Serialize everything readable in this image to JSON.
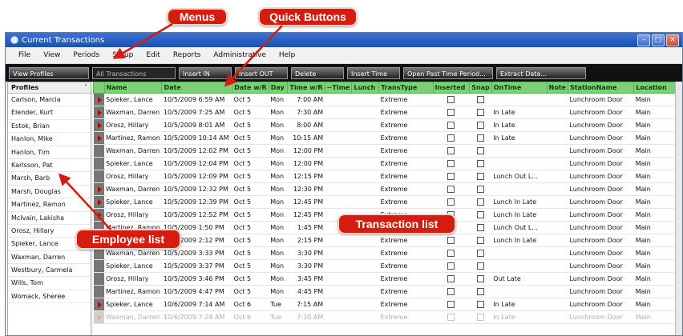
{
  "window": {
    "title": "Current Transactions"
  },
  "menu": [
    "File",
    "View",
    "Periods",
    "Setup",
    "Edit",
    "Reports",
    "Administrative",
    "Help"
  ],
  "toolbar": {
    "view_profiles": "View Profiles",
    "filter": "All Transactions",
    "buttons": [
      "Insert IN",
      "Insert OUT",
      "Delete",
      "Insert Time",
      "Open Past Time Period...",
      "Extract Data..."
    ]
  },
  "profiles": {
    "header": "Profiles",
    "items": [
      "Carlson, Marcia",
      "Elender, Kurt",
      "Estok, Brian",
      "Hanlon, Mike",
      "Hanlon, Tim",
      "Karlsson, Pat",
      "Marsh, Barb",
      "Marsh, Douglas",
      "Martinez, Ramon",
      "McIvain, Lakisha",
      "Orosz, Hillary",
      "Spieker, Lance",
      "Waxman, Darren",
      "Westbury, Carmela",
      "Wills, Tom",
      "Womack, Sheree"
    ]
  },
  "columns": [
    "Name",
    "Date",
    "Date w/R",
    "Day",
    "Time w/R",
    "~Time",
    "Lunch",
    "TransType",
    "Inserted",
    "Snap",
    "OnTime",
    "Note",
    "StationName",
    "Location"
  ],
  "rows": [
    {
      "arrow": true,
      "name": "Spieker, Lance",
      "date": "10/5/2009 6:59 AM",
      "date_r": "Oct 5",
      "day": "Mon",
      "time_r": "7:00 AM",
      "type": "Extreme",
      "ontime": "",
      "station": "Lunchroom Door",
      "loc": "Main"
    },
    {
      "arrow": true,
      "name": "Waxman, Darren",
      "date": "10/5/2009 7:25 AM",
      "date_r": "Oct 5",
      "day": "Mon",
      "time_r": "7:30 AM",
      "type": "Extreme",
      "ontime": "In Late",
      "station": "Lunchroom Door",
      "loc": "Main"
    },
    {
      "arrow": true,
      "name": "Orosz, Hillary",
      "date": "10/5/2009 8:01 AM",
      "date_r": "Oct 5",
      "day": "Mon",
      "time_r": "8:00 AM",
      "type": "Extreme",
      "ontime": "In Late",
      "station": "Lunchroom Door",
      "loc": "Main"
    },
    {
      "arrow": true,
      "name": "Martinez, Ramon",
      "date": "10/5/2009 10:14 AM",
      "date_r": "Oct 5",
      "day": "Mon",
      "time_r": "10:15 AM",
      "type": "Extreme",
      "ontime": "In Late",
      "station": "Lunchroom Door",
      "loc": "Main"
    },
    {
      "arrow": false,
      "name": "Waxman, Darren",
      "date": "10/5/2009 12:02 PM",
      "date_r": "Oct 5",
      "day": "Mon",
      "time_r": "12:00 PM",
      "type": "Extreme",
      "ontime": "",
      "station": "Lunchroom Door",
      "loc": "Main"
    },
    {
      "arrow": false,
      "name": "Spieker, Lance",
      "date": "10/5/2009 12:04 PM",
      "date_r": "Oct 5",
      "day": "Mon",
      "time_r": "12:00 PM",
      "type": "Extreme",
      "ontime": "",
      "station": "Lunchroom Door",
      "loc": "Main"
    },
    {
      "arrow": false,
      "name": "Orosz, Hillary",
      "date": "10/5/2009 12:09 PM",
      "date_r": "Oct 5",
      "day": "Mon",
      "time_r": "12:15 PM",
      "type": "Extreme",
      "ontime": "Lunch Out L...",
      "station": "Lunchroom Door",
      "loc": "Main"
    },
    {
      "arrow": true,
      "name": "Waxman, Darren",
      "date": "10/5/2009 12:32 PM",
      "date_r": "Oct 5",
      "day": "Mon",
      "time_r": "12:30 PM",
      "type": "Extreme",
      "ontime": "",
      "station": "Lunchroom Door",
      "loc": "Main"
    },
    {
      "arrow": true,
      "name": "Spieker, Lance",
      "date": "10/5/2009 12:39 PM",
      "date_r": "Oct 5",
      "day": "Mon",
      "time_r": "12:45 PM",
      "type": "Extreme",
      "ontime": "Lunch In Late",
      "station": "Lunchroom Door",
      "loc": "Main"
    },
    {
      "arrow": true,
      "name": "Orosz, Hillary",
      "date": "10/5/2009 12:52 PM",
      "date_r": "Oct 5",
      "day": "Mon",
      "time_r": "12:45 PM",
      "type": "Extreme",
      "ontime": "Lunch In Late",
      "station": "Lunchroom Door",
      "loc": "Main"
    },
    {
      "arrow": false,
      "name": "Martinez, Ramon",
      "date": "10/5/2009 1:50 PM",
      "date_r": "Oct 5",
      "day": "Mon",
      "time_r": "1:45 PM",
      "type": "Extreme",
      "ontime": "Lunch Out L...",
      "station": "Lunchroom Door",
      "loc": "Main"
    },
    {
      "arrow": true,
      "name": "Martinez, Ramon",
      "date": "10/5/2009 2:12 PM",
      "date_r": "Oct 5",
      "day": "Mon",
      "time_r": "2:15 PM",
      "type": "Extreme",
      "ontime": "Lunch In Late",
      "station": "Lunchroom Door",
      "loc": "Main"
    },
    {
      "arrow": false,
      "name": "Waxman, Darren",
      "date": "10/5/2009 3:33 PM",
      "date_r": "Oct 5",
      "day": "Mon",
      "time_r": "3:30 PM",
      "type": "Extreme",
      "ontime": "",
      "station": "Lunchroom Door",
      "loc": "Main"
    },
    {
      "arrow": false,
      "name": "Spieker, Lance",
      "date": "10/5/2009 3:37 PM",
      "date_r": "Oct 5",
      "day": "Mon",
      "time_r": "3:30 PM",
      "type": "Extreme",
      "ontime": "",
      "station": "Lunchroom Door",
      "loc": "Main"
    },
    {
      "arrow": false,
      "name": "Orosz, Hillary",
      "date": "10/5/2009 3:46 PM",
      "date_r": "Oct 5",
      "day": "Mon",
      "time_r": "3:45 PM",
      "type": "Extreme",
      "ontime": "Out Late",
      "station": "Lunchroom Door",
      "loc": "Main"
    },
    {
      "arrow": false,
      "name": "Martinez, Ramon",
      "date": "10/5/2009 4:47 PM",
      "date_r": "Oct 5",
      "day": "Mon",
      "time_r": "4:45 PM",
      "type": "Extreme",
      "ontime": "",
      "station": "Lunchroom Door",
      "loc": "Main"
    },
    {
      "arrow": true,
      "name": "Spieker, Lance",
      "date": "10/6/2009 7:14 AM",
      "date_r": "Oct 6",
      "day": "Tue",
      "time_r": "7:15 AM",
      "type": "Extreme",
      "ontime": "In Late",
      "station": "Lunchroom Door",
      "loc": "Main"
    },
    {
      "arrow": true,
      "faded": true,
      "name": "Waxman, Darren",
      "date": "10/6/2009 7:24 AM",
      "date_r": "Oct 6",
      "day": "Tue",
      "time_r": "7:30 AM",
      "type": "Extreme",
      "ontime": "In Late",
      "station": "Lunchroom Door",
      "loc": "Main"
    }
  ],
  "callouts": {
    "menus": "Menus",
    "quick_buttons": "Quick Buttons",
    "employee_list": "Employee list",
    "transaction_list": "Transaction list"
  },
  "colors": {
    "header_green": "#7dcf77",
    "callout_red": "#d41d0e",
    "title_blue": "#2b62c4"
  }
}
